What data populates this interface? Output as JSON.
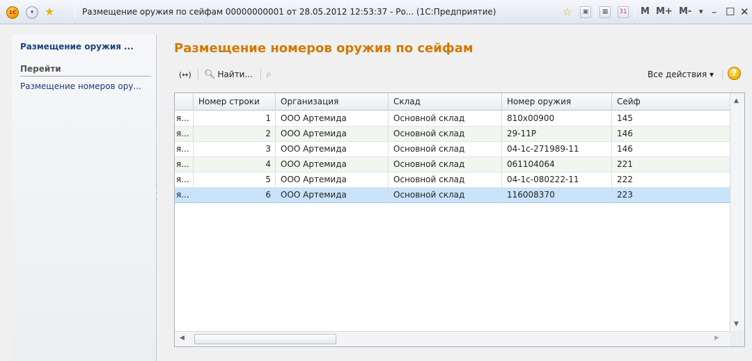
{
  "window": {
    "title": "Размещение оружия по сейфам 00000000001 от 28.05.2012 12:53:37 - Ро...  (1С:Предприятие)",
    "mem_buttons": [
      "M",
      "M+",
      "M-"
    ]
  },
  "sidebar": {
    "title": "Размещение оружия ...",
    "section": "Перейти",
    "items": [
      {
        "label": "Размещение номеров ору..."
      }
    ]
  },
  "main": {
    "title": "Размещение номеров оружия по сейфам",
    "toolbar": {
      "link_label": "(↔)",
      "find_label": "Найти...",
      "all_actions_label": "Все действия ▾",
      "help_label": "?"
    },
    "table": {
      "columns": [
        "Номер строки",
        "Организация",
        "Склад",
        "Номер оружия",
        "Сейф"
      ],
      "rows": [
        {
          "prefix": "я...",
          "num": "1",
          "org": "ООО Артемида",
          "warehouse": "Основной склад",
          "weapon": "810x00900",
          "safe": "145"
        },
        {
          "prefix": "я...",
          "num": "2",
          "org": "ООО Артемида",
          "warehouse": "Основной склад",
          "weapon": "29-11Р",
          "safe": "146"
        },
        {
          "prefix": "я...",
          "num": "3",
          "org": "ООО Артемида",
          "warehouse": "Основной склад",
          "weapon": "04-1с-271989-11",
          "safe": "146"
        },
        {
          "prefix": "я...",
          "num": "4",
          "org": "ООО Артемида",
          "warehouse": "Основной склад",
          "weapon": "061104064",
          "safe": "221"
        },
        {
          "prefix": "я...",
          "num": "5",
          "org": "ООО Артемида",
          "warehouse": "Основной склад",
          "weapon": "04-1с-080222-11",
          "safe": "222"
        },
        {
          "prefix": "я...",
          "num": "6",
          "org": "ООО Артемида",
          "warehouse": "Основной склад",
          "weapon": "116008370",
          "safe": "223"
        }
      ],
      "selected_row": 6
    }
  },
  "colors": {
    "title_orange": "#d27a00",
    "sidebar_title_blue": "#1a4280",
    "selected_row": "#c9e3fb"
  }
}
